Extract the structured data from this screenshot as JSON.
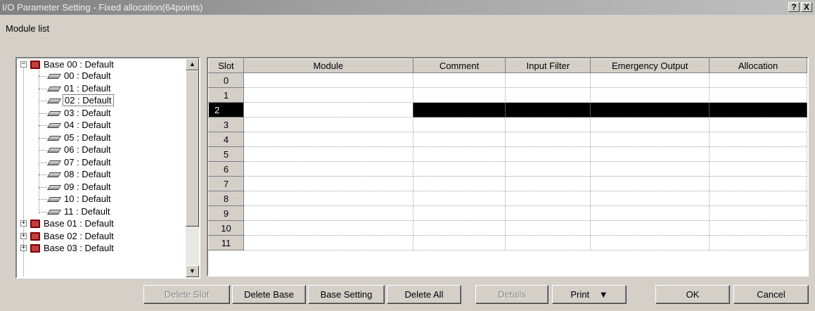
{
  "window": {
    "title": "I/O Parameter Setting - Fixed allocation(64points)",
    "help_glyph": "?",
    "close_glyph": "X"
  },
  "module_list_label": "Module list",
  "tree": {
    "base00": "Base 00 : Default",
    "modules": [
      "00 : Default",
      "01 : Default",
      "02 : Default",
      "03 : Default",
      "04 : Default",
      "05 : Default",
      "06 : Default",
      "07 : Default",
      "08 : Default",
      "09 : Default",
      "10 : Default",
      "11 : Default"
    ],
    "selected_module_index": 2,
    "other_bases": [
      "Base 01 : Default",
      "Base 02 : Default",
      "Base 03 : Default"
    ],
    "expand_glyph": "+",
    "collapse_glyph": "−",
    "scroll_up": "▲",
    "scroll_down": "▼"
  },
  "grid": {
    "columns": [
      "Slot",
      "Module",
      "Comment",
      "Input Filter",
      "Emergency Output",
      "Allocation"
    ],
    "slots": [
      "0",
      "1",
      "2",
      "3",
      "4",
      "5",
      "6",
      "7",
      "8",
      "9",
      "10",
      "11"
    ],
    "selected_slot_index": 2
  },
  "buttons": {
    "delete_slot": "Delete Slot",
    "delete_base": "Delete Base",
    "base_setting": "Base Setting",
    "delete_all": "Delete All",
    "details": "Details",
    "print": "Print",
    "print_arrow": "▼",
    "ok": "OK",
    "cancel": "Cancel"
  }
}
